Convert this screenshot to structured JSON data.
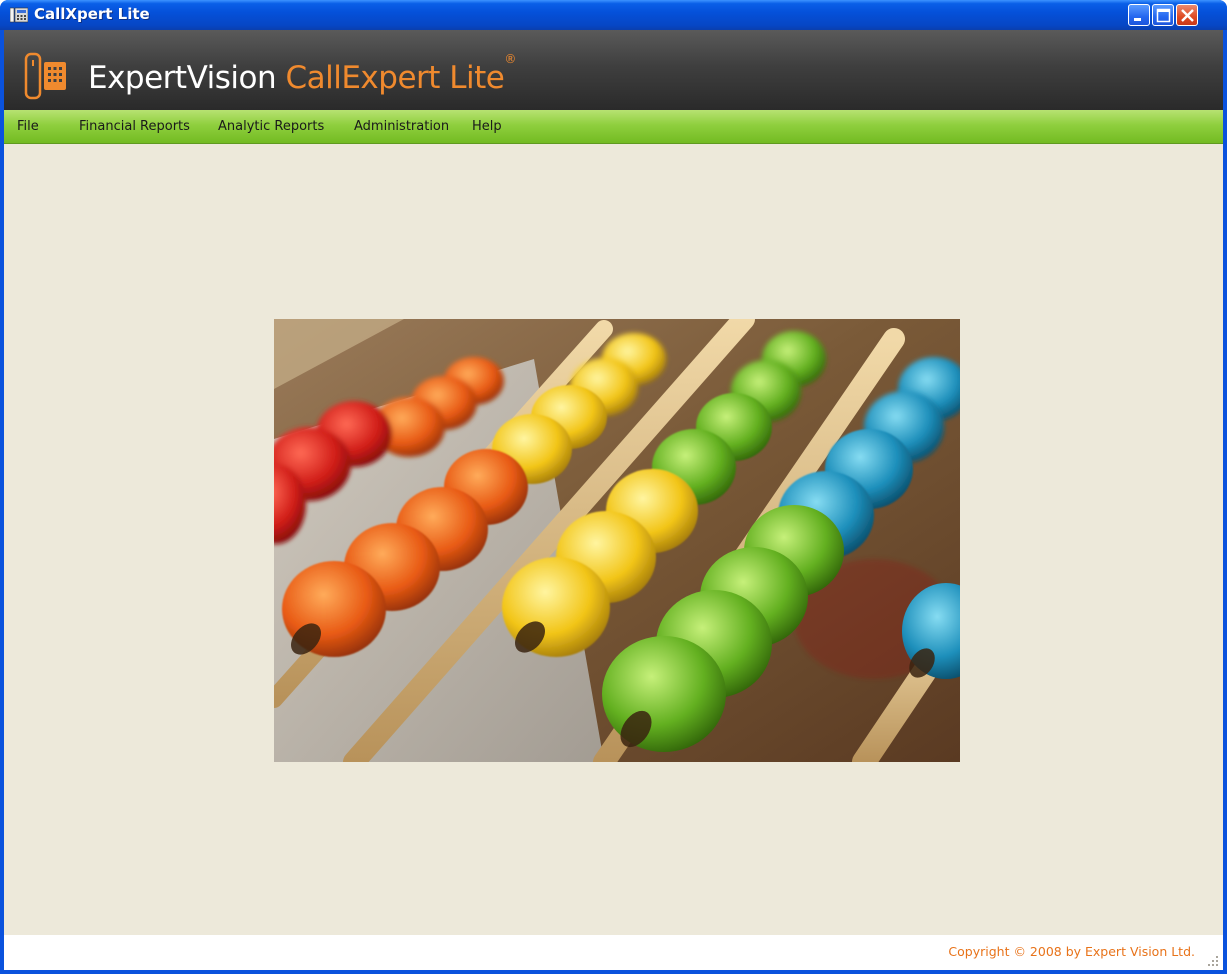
{
  "window": {
    "title": "CallXpert Lite"
  },
  "banner": {
    "brand_main": "ExpertVision",
    "brand_sub": "CallExpert Lite",
    "registered_mark": "®"
  },
  "menu": {
    "items": [
      {
        "label": "File"
      },
      {
        "label": "Financial Reports"
      },
      {
        "label": "Analytic Reports"
      },
      {
        "label": "Administration"
      },
      {
        "label": "Help"
      }
    ]
  },
  "main": {
    "image_icon": "abacus-photo"
  },
  "statusbar": {
    "copyright": "Copyright © 2008 by Expert Vision Ltd."
  },
  "icons": {
    "app": "app-icon",
    "minimize": "minimize-icon",
    "maximize": "maximize-icon",
    "close": "close-icon",
    "logo": "phone-logo-icon",
    "grip": "resize-grip-icon"
  },
  "colors": {
    "title_bar": "#0a52dd",
    "banner": "#3f3f3f",
    "menu_bar": "#8fcf3e",
    "accent_orange": "#f08a2e",
    "client_bg": "#ede9da"
  }
}
